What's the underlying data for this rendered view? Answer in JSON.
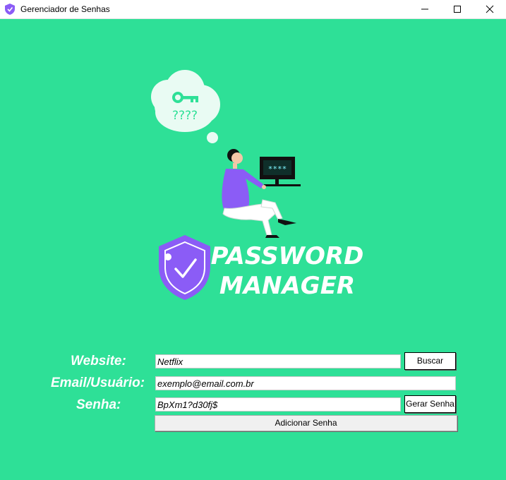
{
  "window": {
    "title": "Gerenciador de Senhas"
  },
  "logo": {
    "line1": "PASSWORD",
    "line2": "MANAGER",
    "thought": "????",
    "screen": "****"
  },
  "form": {
    "website_label": "Website:",
    "website_value": "Netflix",
    "email_label": "Email/Usuário:",
    "email_value": "exemplo@email.com.br",
    "password_label": "Senha:",
    "password_value": "BpXm1?d30fj$",
    "search_button": "Buscar",
    "generate_button": "Gerar Senha",
    "add_button": "Adicionar Senha"
  },
  "colors": {
    "background": "#2ee097",
    "accent": "#8b5cf6",
    "text": "#ffffff"
  }
}
